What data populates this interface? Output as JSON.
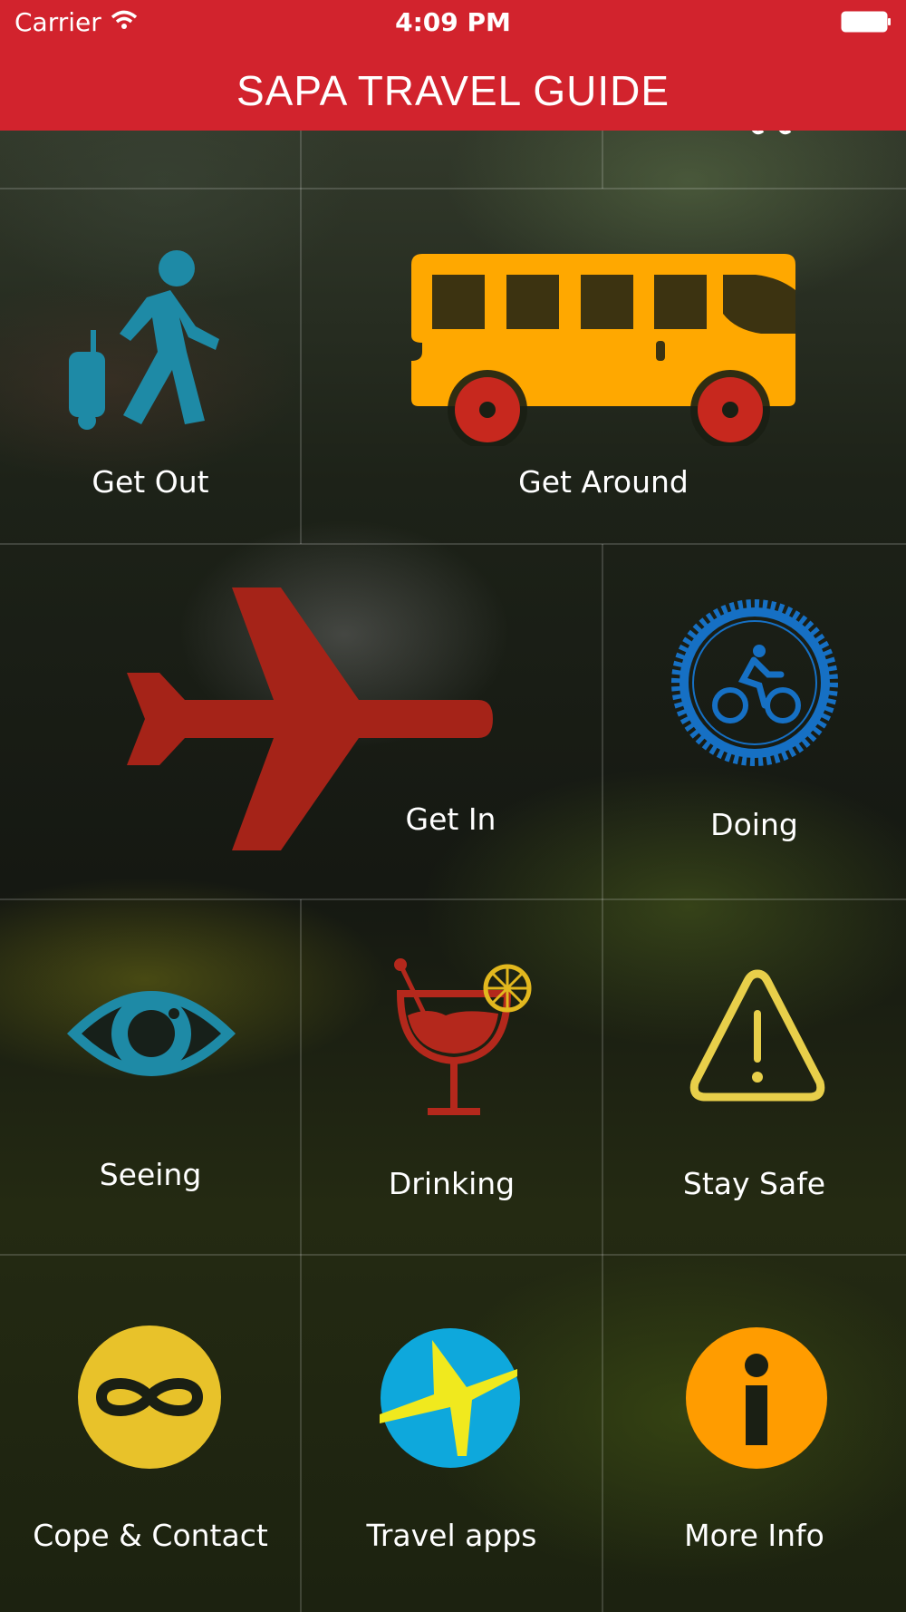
{
  "status_bar": {
    "carrier": "Carrier",
    "time": "4:09 PM"
  },
  "nav": {
    "title": "SAPA TRAVEL GUIDE"
  },
  "colors": {
    "nav_bg": "#d2232d",
    "teal": "#1e8aa6",
    "bus_yellow": "#ffa800",
    "plane_red": "#a52318",
    "cycle_blue": "#1670c4",
    "drink_red": "#b4281c",
    "warning_yellow": "#e8cf4a",
    "contact_yellow": "#e8c22a",
    "apps_blue": "#0ea8dc",
    "info_orange": "#ff9c00"
  },
  "tiles": [
    {
      "label": "Get Out",
      "icon": "traveler-luggage-icon"
    },
    {
      "label": "Get Around",
      "icon": "bus-icon"
    },
    {
      "label": "Get In",
      "icon": "airplane-icon"
    },
    {
      "label": "Doing",
      "icon": "bicycle-badge-icon"
    },
    {
      "label": "Seeing",
      "icon": "eye-icon"
    },
    {
      "label": "Drinking",
      "icon": "cocktail-icon"
    },
    {
      "label": "Stay Safe",
      "icon": "warning-icon"
    },
    {
      "label": "Cope & Contact",
      "icon": "infinity-icon"
    },
    {
      "label": "Travel apps",
      "icon": "expedia-plane-icon"
    },
    {
      "label": "More Info",
      "icon": "info-icon"
    }
  ]
}
